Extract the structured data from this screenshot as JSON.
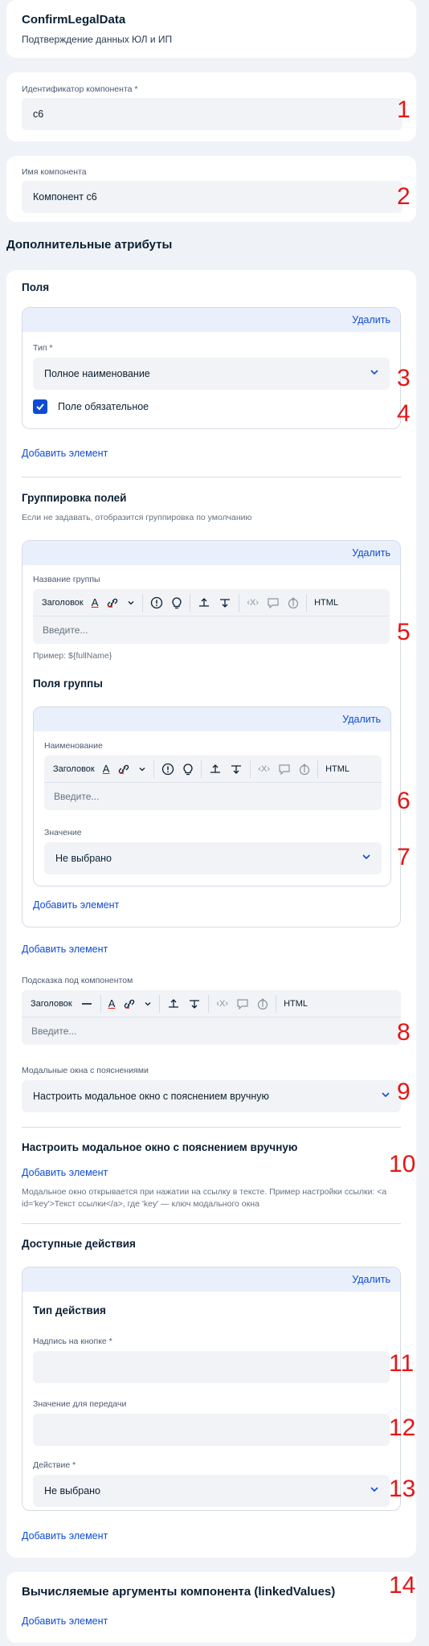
{
  "header": {
    "title": "ConfirmLegalData",
    "subtitle": "Подтверждение данных ЮЛ и ИП"
  },
  "component_id": {
    "label": "Идентификатор компонента *",
    "value": "c6"
  },
  "component_name": {
    "label": "Имя компонента",
    "value": "Компонент с6"
  },
  "additional_attributes_title": "Дополнительные атрибуты",
  "fields_section": {
    "title": "Поля",
    "delete": "Удалить",
    "type_label": "Тип *",
    "type_value": "Полное наименование",
    "required_label": "Поле обязательное",
    "required_checked": true,
    "add": "Добавить элемент"
  },
  "grouping": {
    "title": "Группировка полей",
    "hint": "Если не задавать, отобразится группировка по умолчанию",
    "delete": "Удалить",
    "group_name_label": "Название группы",
    "placeholder": "Введите...",
    "example": "Пример: ${fullName}",
    "group_fields_title": "Поля группы",
    "inner_delete": "Удалить",
    "name_label": "Наименование",
    "value_label": "Значение",
    "value_select": "Не выбрано",
    "inner_add": "Добавить элемент",
    "add": "Добавить элемент"
  },
  "toolbar": {
    "heading": "Заголовок",
    "html": "HTML",
    "text_color": "A",
    "code": "‹X›"
  },
  "hint_under": {
    "label": "Подсказка под компонентом",
    "placeholder": "Введите..."
  },
  "modals": {
    "label": "Модальные окна с пояснениями",
    "value": "Настроить модальное окно с пояснением вручную"
  },
  "manual_modal": {
    "title": "Настроить модальное окно с пояснением вручную",
    "add": "Добавить элемент",
    "hint": "Модальное окно открывается при нажатии на ссылку в тексте. Пример настройки ссылки: <a id='key'>Текст ссылки</a>, где 'key' — ключ модального окна"
  },
  "actions": {
    "title": "Доступные действия",
    "delete": "Удалить",
    "action_type_title": "Тип действия",
    "button_label": "Надпись на кнопке *",
    "value_label": "Значение для передачи",
    "action_label": "Действие *",
    "action_value": "Не выбрано",
    "add": "Добавить элемент"
  },
  "linked_values": {
    "title": "Вычисляемые аргументы компонента (linkedValues)",
    "add": "Добавить элемент"
  },
  "annotations": [
    "1",
    "2",
    "3",
    "4",
    "5",
    "6",
    "7",
    "8",
    "9",
    "10",
    "11",
    "12",
    "13",
    "14"
  ],
  "colors": {
    "accent": "#0d4cd3",
    "annotation": "#e51515",
    "background": "#eff2f7"
  },
  "icons": [
    "chevron-down-icon",
    "checkbox-check-icon",
    "text-color-icon",
    "link-icon",
    "warning-icon",
    "lightbulb-icon",
    "insert-above-icon",
    "insert-below-icon",
    "code-icon",
    "comment-icon",
    "upload-icon",
    "horizontal-rule-icon"
  ]
}
